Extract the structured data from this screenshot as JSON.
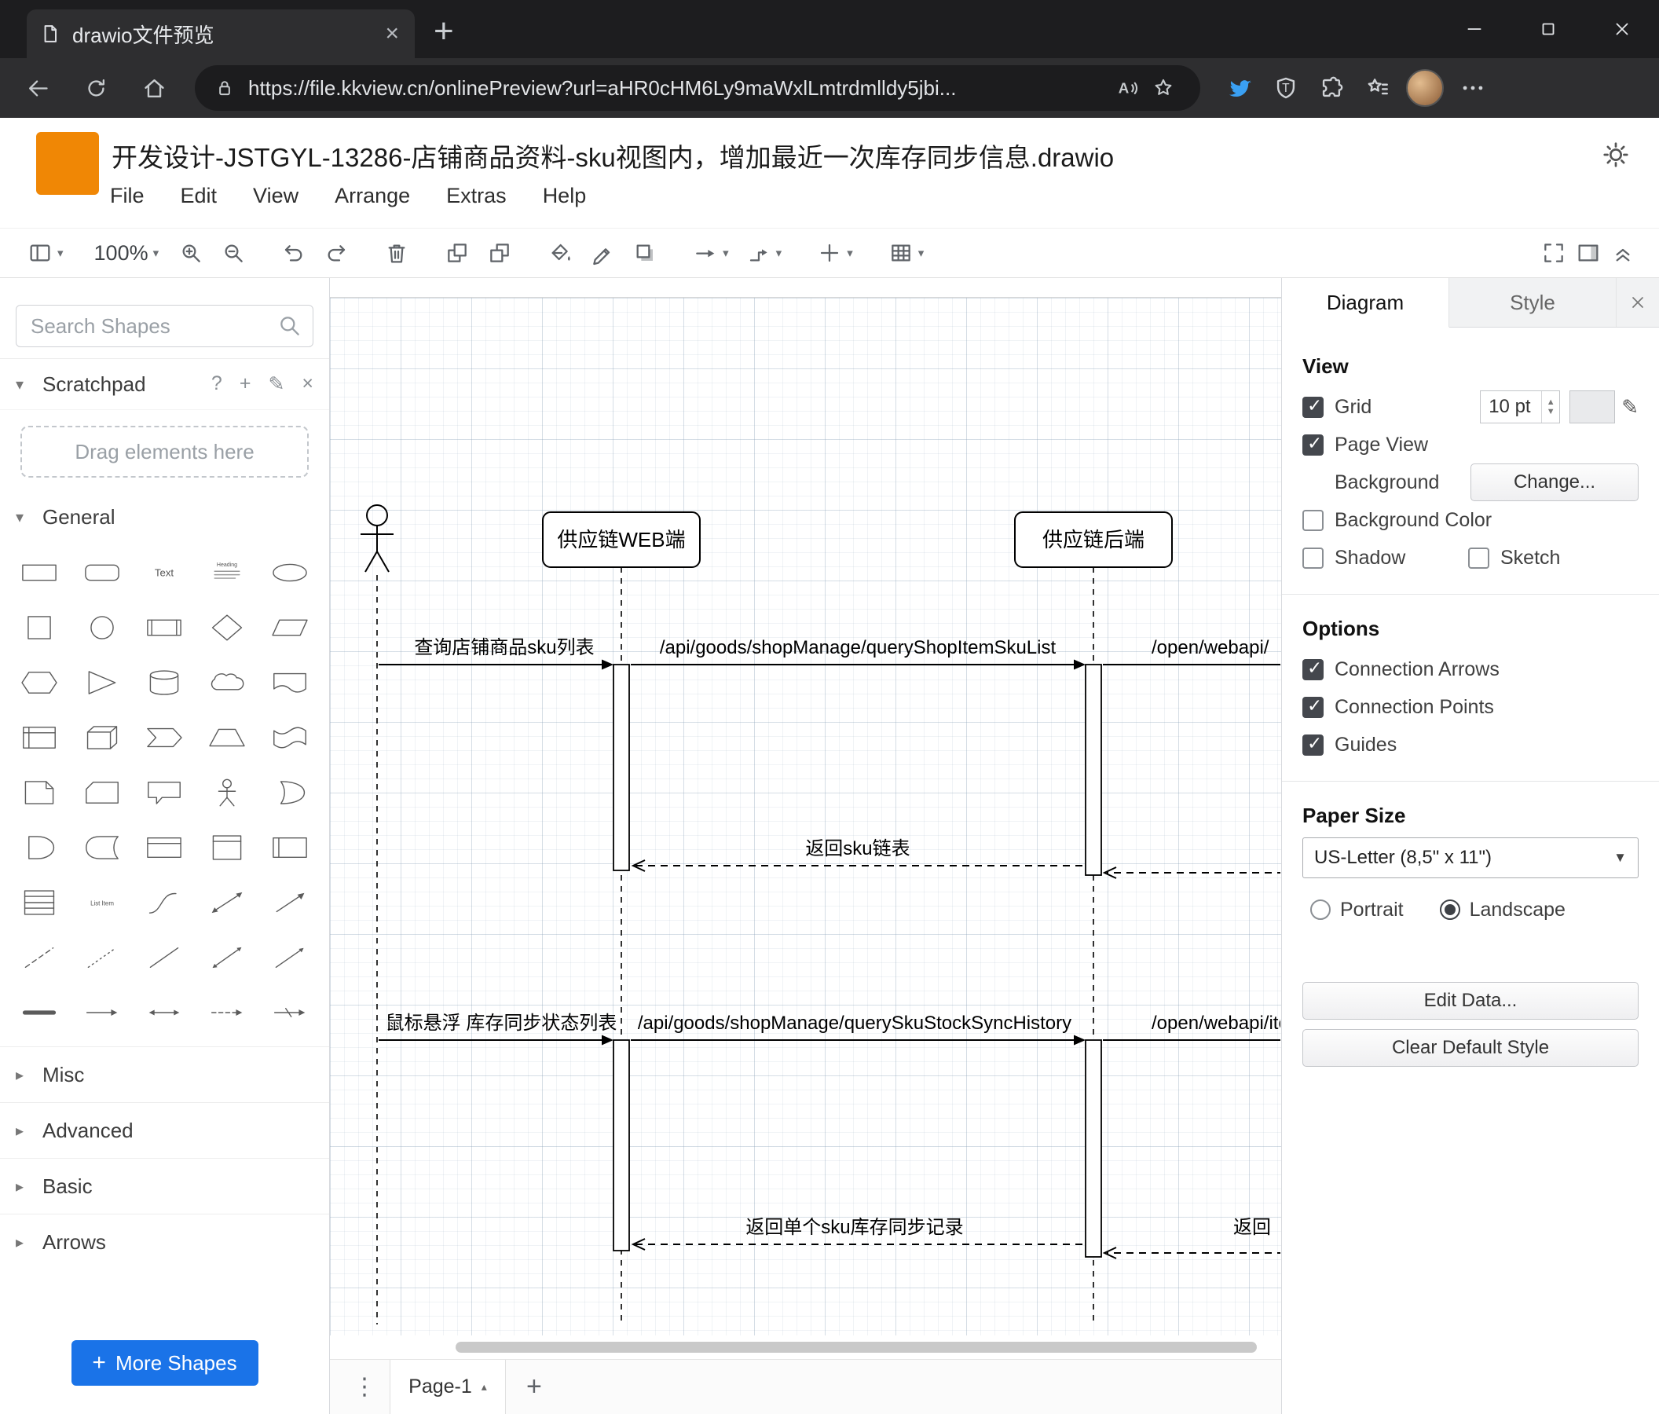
{
  "browser": {
    "tab_title": "drawio文件预览",
    "url": "https://file.kkview.cn/onlinePreview?url=aHR0cHM6Ly9maWxlLmtrdmlldy5jbi...",
    "nav_icons": [
      "back",
      "refresh",
      "home"
    ],
    "pill_icons": [
      "read-aloud",
      "star"
    ],
    "ext_icons": [
      "bird",
      "shield",
      "puzzle",
      "collections",
      "avatar",
      "more-dots"
    ],
    "window_controls": [
      "minimize",
      "maximize",
      "close"
    ]
  },
  "app": {
    "doc_title": "开发设计-JSTGYL-13286-店铺商品资料-sku视图内，增加最近一次库存同步信息.drawio",
    "menu": [
      "File",
      "Edit",
      "View",
      "Arrange",
      "Extras",
      "Help"
    ],
    "theme_icon": "sun",
    "toolbar": {
      "zoom": "100%",
      "items": [
        {
          "icon": "view",
          "caret": true
        },
        {
          "zoom": true
        },
        {
          "icon": "zoom-in"
        },
        {
          "icon": "zoom-out"
        },
        {
          "icon": "undo",
          "group": true
        },
        {
          "icon": "redo"
        },
        {
          "icon": "trash",
          "group": true
        },
        {
          "icon": "to-front",
          "group": true
        },
        {
          "icon": "to-back"
        },
        {
          "icon": "fill-color",
          "group": true
        },
        {
          "icon": "line-color"
        },
        {
          "icon": "shadow"
        },
        {
          "icon": "connection",
          "caret": true,
          "group": true
        },
        {
          "icon": "waypoint",
          "caret": true
        },
        {
          "icon": "insert-plus",
          "caret": true,
          "group": true
        },
        {
          "icon": "table",
          "caret": true,
          "group": true
        }
      ],
      "right_items": [
        "fullscreen",
        "format-panel",
        "collapse"
      ]
    }
  },
  "sidebar": {
    "search_placeholder": "Search Shapes",
    "scratchpad": {
      "label": "Scratchpad",
      "hint": "Drag elements here",
      "icons": [
        {
          "name": "help",
          "glyph": "?"
        },
        {
          "name": "add",
          "glyph": "+"
        },
        {
          "name": "edit",
          "glyph": "✎"
        },
        {
          "name": "close",
          "glyph": "×"
        }
      ]
    },
    "sections": [
      {
        "label": "General",
        "expanded": true
      },
      {
        "label": "Misc",
        "expanded": false
      },
      {
        "label": "Advanced",
        "expanded": false
      },
      {
        "label": "Basic",
        "expanded": false
      },
      {
        "label": "Arrows",
        "expanded": false
      }
    ],
    "shapes": [
      "rectangle",
      "rounded-rectangle",
      "text",
      "textbox",
      "ellipse",
      "square",
      "circle",
      "process",
      "diamond",
      "parallelogram",
      "hexagon",
      "triangle",
      "cylinder",
      "cloud",
      "document",
      "internal-storage",
      "cube",
      "step",
      "trapezoid",
      "tape",
      "note",
      "card",
      "callout",
      "actor",
      "or",
      "and",
      "data-storage",
      "container",
      "vertical-container",
      "horizontal-container",
      "list",
      "list-item",
      "curve",
      "bidirectional-arrow",
      "arrow",
      "dashed-line",
      "dotted-line",
      "line",
      "bidirectional-connector",
      "directional-connector",
      "link",
      "arrow-h",
      "double-arrow-h",
      "dashed-arrow-h",
      "cross-arrow-h"
    ],
    "more_shapes": "More Shapes"
  },
  "canvas": {
    "pages": [
      {
        "label": "Page-1"
      }
    ],
    "diagram": {
      "lifelines": [
        {
          "type": "actor",
          "name": "user"
        },
        {
          "type": "lifeline",
          "label": "供应链WEB端"
        },
        {
          "type": "lifeline",
          "label": "供应链后端"
        }
      ],
      "messages": [
        {
          "text": "查询店铺商品sku列表",
          "kind": "sync"
        },
        {
          "text": "/api/goods/shopManage/queryShopItemSkuList",
          "kind": "sync"
        },
        {
          "text": "/open/webapi/",
          "kind": "sync"
        },
        {
          "text": "返回sku链表",
          "kind": "return"
        },
        {
          "text": "",
          "kind": "return"
        },
        {
          "text": "鼠标悬浮 库存同步状态列表",
          "kind": "sync"
        },
        {
          "text": "/api/goods/shopManage/querySkuStockSyncHistory",
          "kind": "sync"
        },
        {
          "text": "/open/webapi/item",
          "kind": "sync"
        },
        {
          "text": "返回单个sku库存同步记录",
          "kind": "return"
        },
        {
          "text": "返回",
          "kind": "return"
        }
      ]
    }
  },
  "panel": {
    "tabs": [
      "Diagram",
      "Style"
    ],
    "view": {
      "heading": "View",
      "grid": {
        "label": "Grid",
        "checked": true,
        "size": "10 pt"
      },
      "page_view": {
        "label": "Page View",
        "checked": true
      },
      "background": {
        "label": "Background",
        "button": "Change..."
      },
      "background_color": {
        "label": "Background Color",
        "checked": false
      },
      "shadow": {
        "label": "Shadow",
        "checked": false
      },
      "sketch": {
        "label": "Sketch",
        "checked": false
      }
    },
    "options": {
      "heading": "Options",
      "items": [
        {
          "label": "Connection Arrows",
          "checked": true
        },
        {
          "label": "Connection Points",
          "checked": true
        },
        {
          "label": "Guides",
          "checked": true
        }
      ]
    },
    "paper": {
      "heading": "Paper Size",
      "value": "US-Letter (8,5\" x 11\")",
      "portrait_label": "Portrait",
      "portrait_checked": false,
      "landscape_label": "Landscape",
      "landscape_checked": true
    },
    "buttons": [
      "Edit Data...",
      "Clear Default Style"
    ]
  }
}
